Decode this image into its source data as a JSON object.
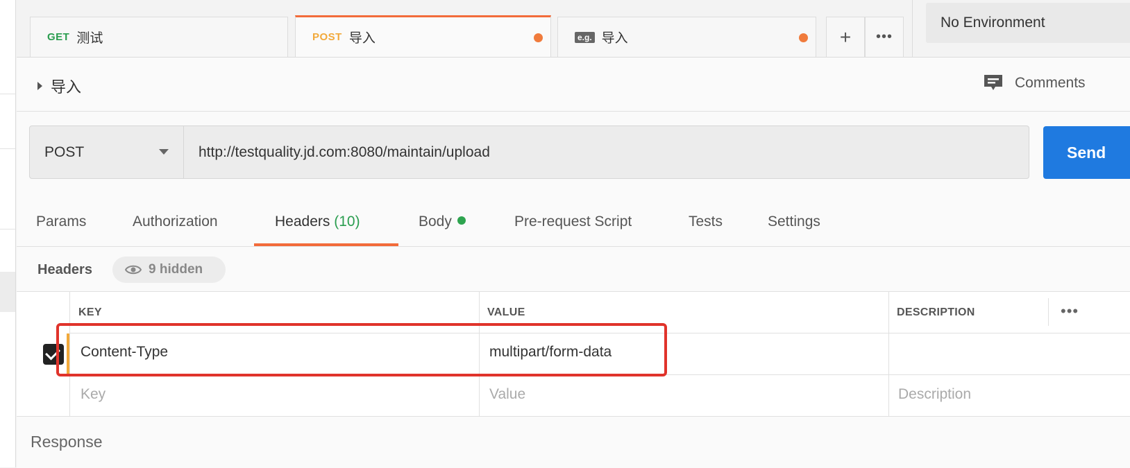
{
  "tabs": [
    {
      "method": "GET",
      "title": "测试"
    },
    {
      "method": "POST",
      "title": "导入",
      "unsaved": true
    },
    {
      "method": "e.g.",
      "title": "导入",
      "unsaved": true
    }
  ],
  "tab_actions": {
    "add": "+",
    "more": "•••"
  },
  "environment": {
    "selected": "No Environment"
  },
  "request": {
    "name": "导入",
    "comments_label": "Comments",
    "method": "POST",
    "url": "http://testquality.jd.com:8080/maintain/upload",
    "send_label": "Send"
  },
  "request_tabs": [
    {
      "label": "Params"
    },
    {
      "label": "Authorization"
    },
    {
      "label": "Headers",
      "count": "(10)",
      "active": true
    },
    {
      "label": "Body",
      "has_content": true
    },
    {
      "label": "Pre-request Script"
    },
    {
      "label": "Tests"
    },
    {
      "label": "Settings"
    }
  ],
  "headers_section": {
    "title": "Headers",
    "hidden_label": "9 hidden",
    "columns": {
      "key": "KEY",
      "value": "VALUE",
      "description": "DESCRIPTION"
    },
    "more": "•••",
    "rows": [
      {
        "enabled": true,
        "key": "Content-Type",
        "value": "multipart/form-data",
        "description": ""
      }
    ],
    "placeholder": {
      "key": "Key",
      "value": "Value",
      "description": "Description"
    }
  },
  "response": {
    "label": "Response"
  },
  "colors": {
    "accent": "#f26b3a",
    "send": "#1f7ae0",
    "highlight": "#e0332b",
    "get": "#2a9d4f",
    "post": "#f2a93b"
  }
}
